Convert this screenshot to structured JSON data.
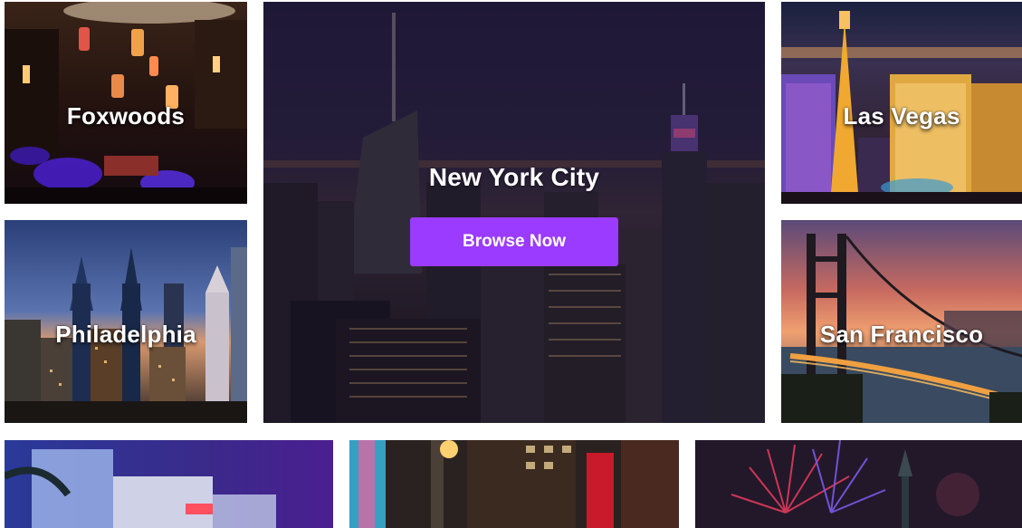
{
  "tiles": {
    "foxwoods": {
      "label": "Foxwoods"
    },
    "philadelphia": {
      "label": "Philadelphia"
    },
    "new_york": {
      "label": "New York City",
      "button_label": "Browse Now"
    },
    "las_vegas": {
      "label": "Las Vegas"
    },
    "san_francisco": {
      "label": "San Francisco"
    }
  },
  "colors": {
    "accent": "#9b3bff",
    "label_text": "#ffffff",
    "page_background": "#ffffff"
  }
}
